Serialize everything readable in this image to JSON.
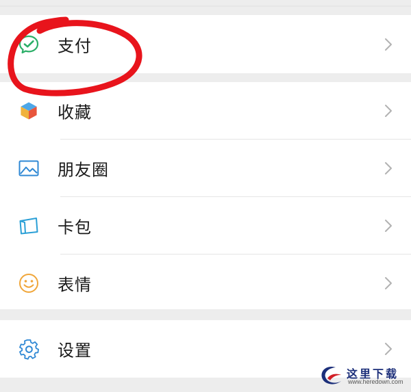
{
  "menu": {
    "pay": {
      "label": "支付",
      "icon": "wechat-pay-icon"
    },
    "items": [
      {
        "label": "收藏",
        "icon": "cube-icon"
      },
      {
        "label": "朋友圈",
        "icon": "picture-icon"
      },
      {
        "label": "卡包",
        "icon": "card-wallet-icon"
      },
      {
        "label": "表情",
        "icon": "smiley-icon"
      }
    ],
    "settings": {
      "label": "设置",
      "icon": "gear-icon"
    }
  },
  "annotation": {
    "type": "red-circle",
    "color": "#e8141c",
    "target": "pay"
  },
  "watermark": {
    "title": "这里下载",
    "url": "www.heredown.com"
  },
  "colors": {
    "background": "#ededed",
    "row": "#ffffff",
    "text": "#191919",
    "pay_green": "#2aae67",
    "chevron": "#b2b2b2"
  }
}
